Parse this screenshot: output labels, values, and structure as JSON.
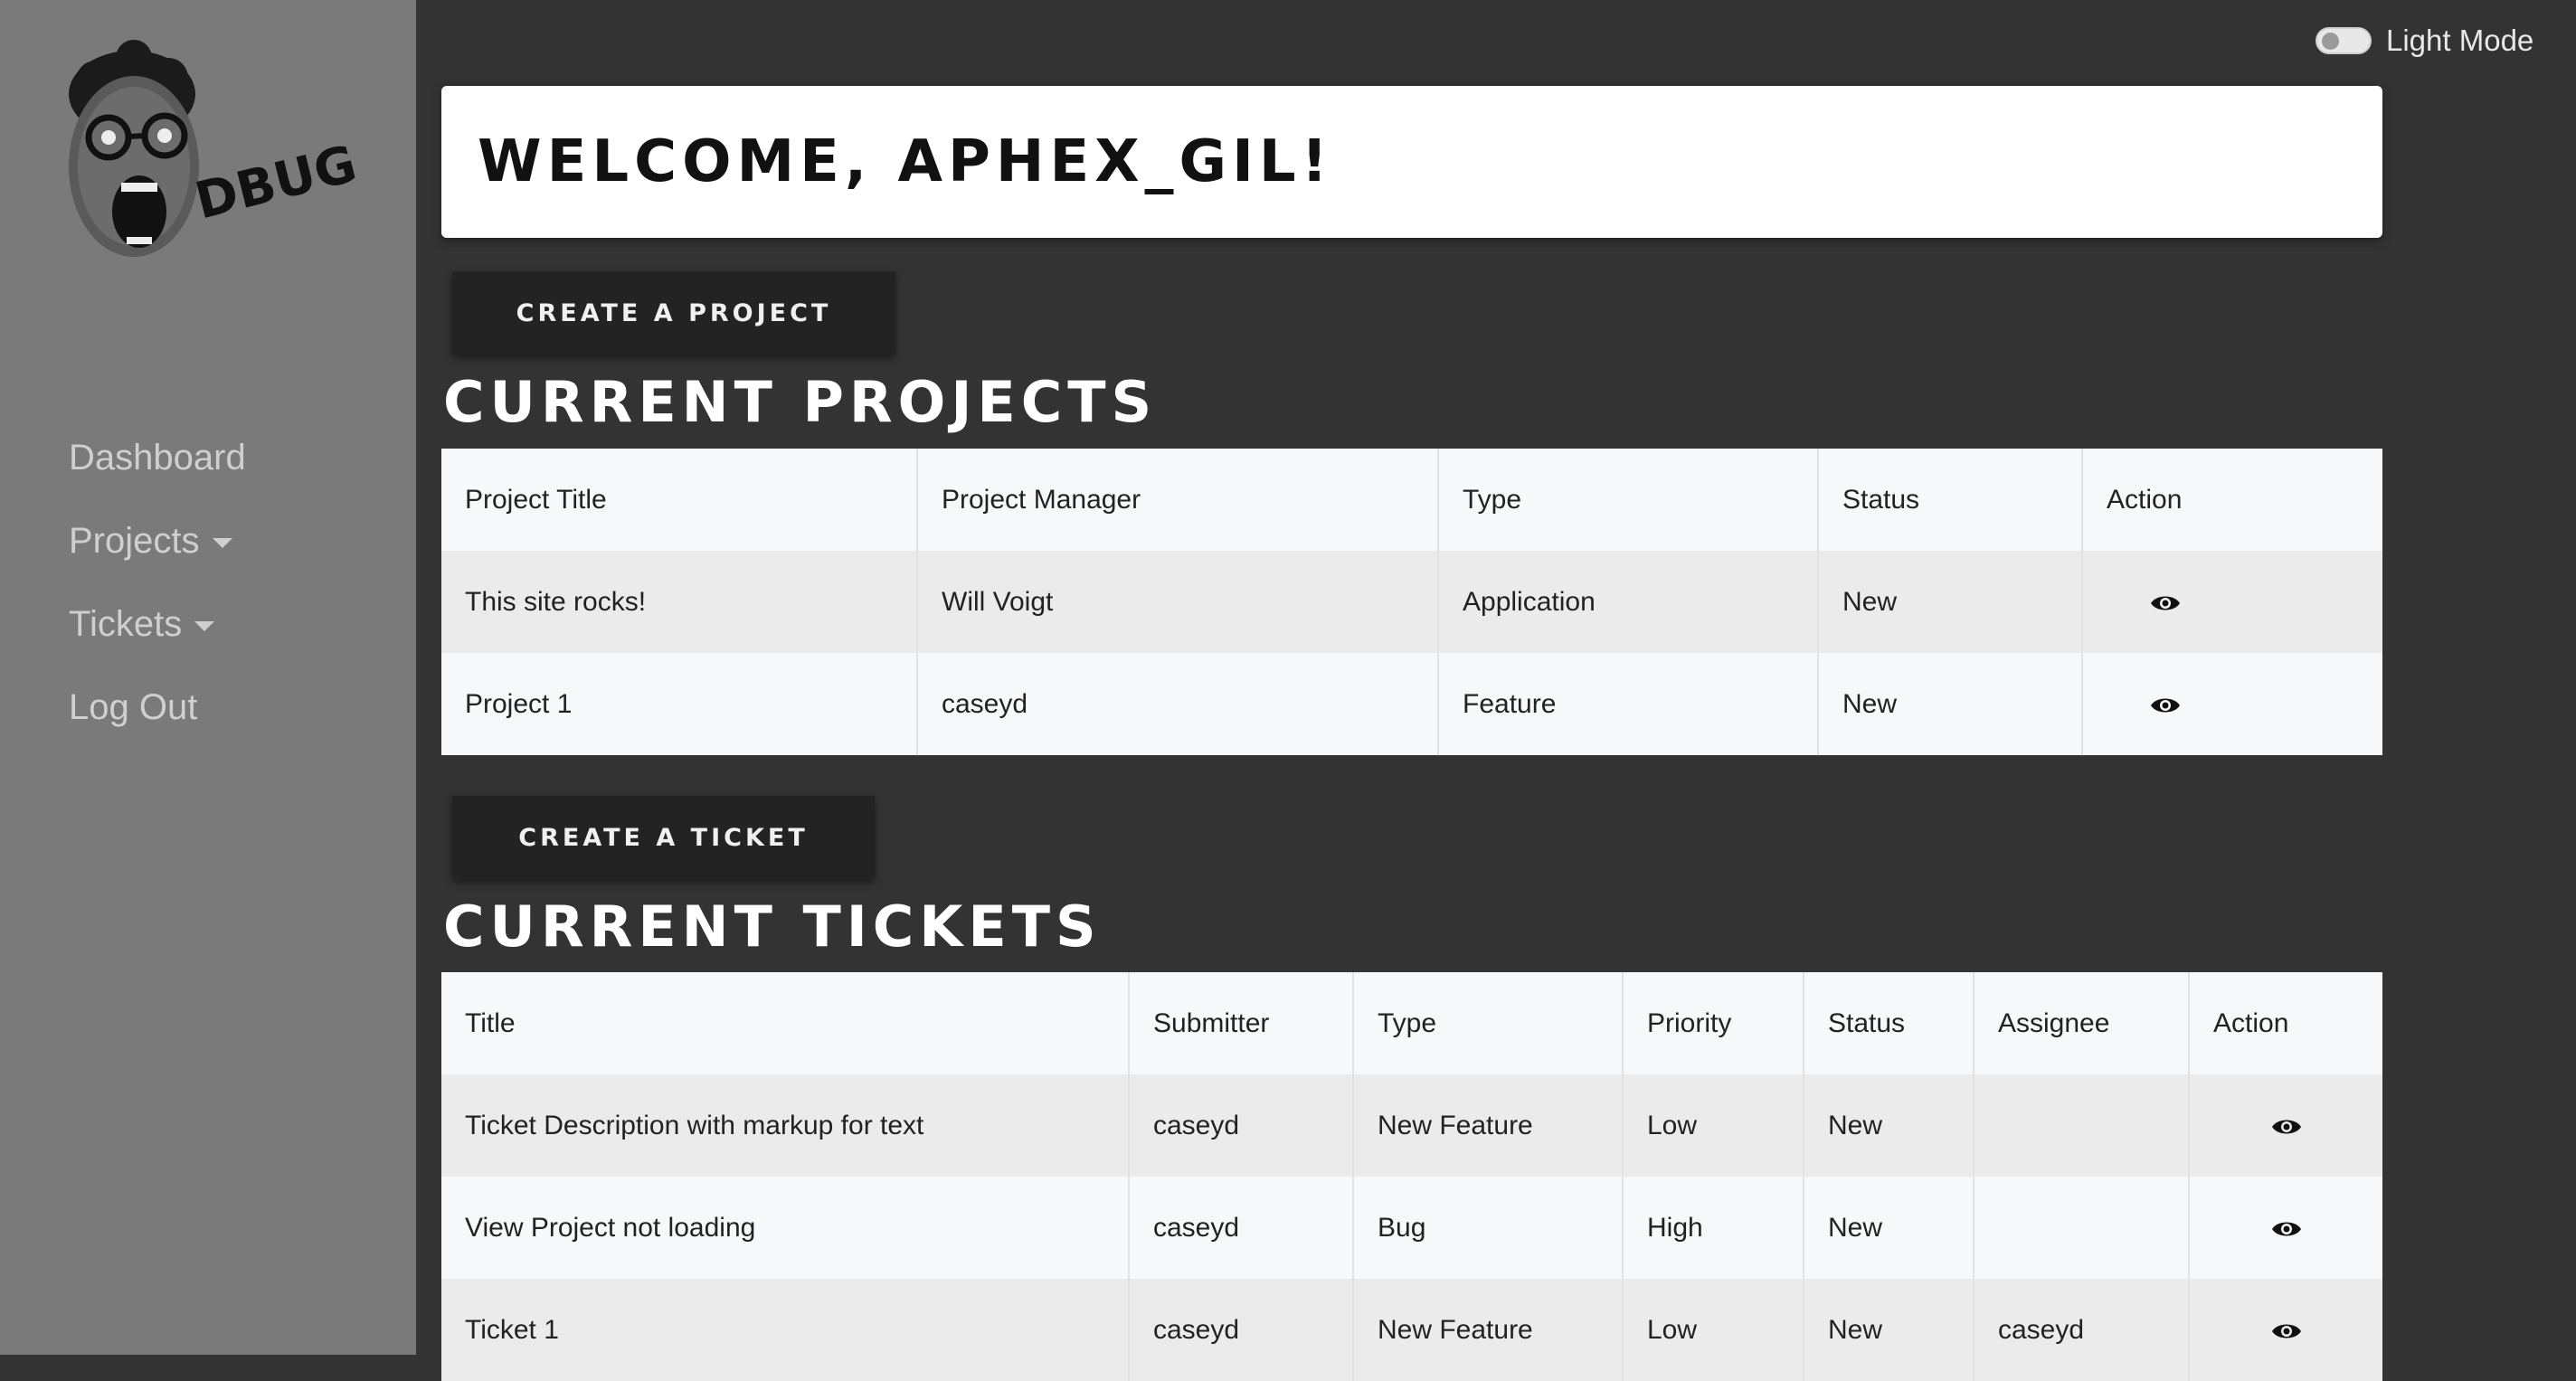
{
  "brand": {
    "name": "DBUG"
  },
  "sidebar": {
    "items": [
      {
        "label": "Dashboard",
        "dropdown": false
      },
      {
        "label": "Projects",
        "dropdown": true
      },
      {
        "label": "Tickets",
        "dropdown": true
      },
      {
        "label": "Log Out",
        "dropdown": false
      }
    ]
  },
  "header": {
    "toggle_label": "Light Mode",
    "toggle_on": false
  },
  "welcome": {
    "text": "WELCOME, APHEX_GIL!"
  },
  "projects": {
    "create_label": "CREATE A PROJECT",
    "title": "CURRENT PROJECTS",
    "columns": [
      "Project Title",
      "Project Manager",
      "Type",
      "Status",
      "Action"
    ],
    "rows": [
      {
        "title": "This site rocks!",
        "manager": "Will Voigt",
        "type": "Application",
        "status": "New",
        "action": "eye-icon"
      },
      {
        "title": "Project 1",
        "manager": "caseyd",
        "type": "Feature",
        "status": "New",
        "action": "eye-icon"
      }
    ]
  },
  "tickets": {
    "create_label": "CREATE A TICKET",
    "title": "CURRENT TICKETS",
    "columns": [
      "Title",
      "Submitter",
      "Type",
      "Priority",
      "Status",
      "Assignee",
      "Action"
    ],
    "rows": [
      {
        "title": "Ticket Description with markup for text",
        "submitter": "caseyd",
        "type": "New Feature",
        "priority": "Low",
        "status": "New",
        "assignee": "",
        "action": "eye-icon"
      },
      {
        "title": "View Project not loading",
        "submitter": "caseyd",
        "type": "Bug",
        "priority": "High",
        "status": "New",
        "assignee": "",
        "action": "eye-icon"
      },
      {
        "title": "Ticket 1",
        "submitter": "caseyd",
        "type": "New Feature",
        "priority": "Low",
        "status": "New",
        "assignee": "caseyd",
        "action": "eye-icon"
      }
    ]
  },
  "colors": {
    "sidebar": "#7a7a7a",
    "background": "#333333",
    "button": "#232323"
  }
}
